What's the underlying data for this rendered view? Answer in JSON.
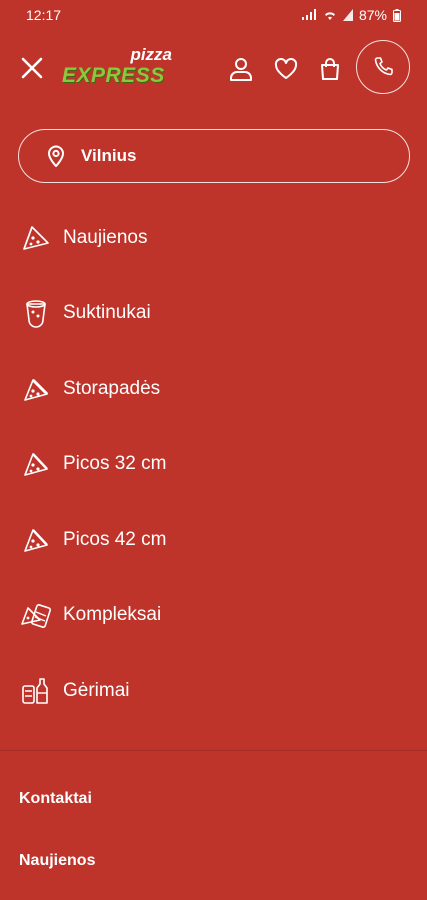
{
  "status_bar": {
    "time": "12:17",
    "battery": "87%"
  },
  "header": {
    "logo_top": "pizza",
    "logo_main": "EXPRESS"
  },
  "location": {
    "city": "Vilnius"
  },
  "menu": [
    {
      "label": "Naujienos",
      "icon": "pizza-slice-icon"
    },
    {
      "label": "Suktinukai",
      "icon": "roll-icon"
    },
    {
      "label": "Storapadės",
      "icon": "pizza-slice-icon"
    },
    {
      "label": "Picos 32 cm",
      "icon": "pizza-slice-icon"
    },
    {
      "label": "Picos 42 cm",
      "icon": "pizza-slice-icon"
    },
    {
      "label": "Kompleksai",
      "icon": "combo-icon"
    },
    {
      "label": "Gėrimai",
      "icon": "drinks-icon"
    }
  ],
  "footer_links": [
    {
      "label": "Kontaktai"
    },
    {
      "label": "Naujienos"
    }
  ],
  "colors": {
    "background": "#BE342B",
    "logo_green": "#8DC63F"
  }
}
